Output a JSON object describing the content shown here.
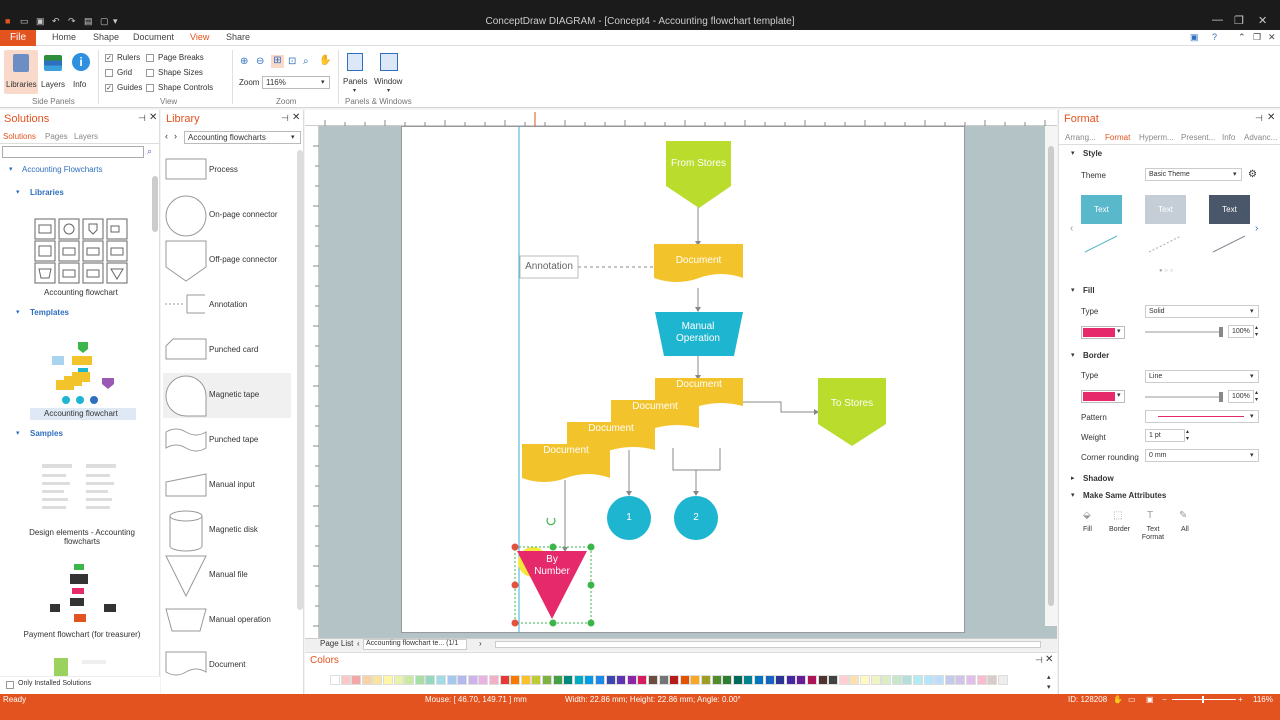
{
  "window": {
    "title": "ConceptDraw DIAGRAM - [Concept4 - Accounting flowchart template]"
  },
  "menu": {
    "file": "File",
    "tabs": [
      "Home",
      "Shape",
      "Document",
      "View",
      "Share"
    ],
    "active": "View"
  },
  "ribbon": {
    "side_panels": {
      "libraries": "Libraries",
      "layers": "Layers",
      "info": "Info",
      "group": "Side Panels"
    },
    "view": {
      "rulers": "Rulers",
      "grid": "Grid",
      "guides": "Guides",
      "page_breaks": "Page Breaks",
      "shape_sizes": "Shape Sizes",
      "shape_controls": "Shape Controls",
      "group": "View"
    },
    "zoom": {
      "label": "Zoom",
      "value": "116%",
      "group": "Zoom"
    },
    "panels": {
      "panels": "Panels",
      "window": "Window",
      "group": "Panels & Windows"
    }
  },
  "solutions": {
    "title": "Solutions",
    "tabs": [
      "Solutions",
      "Pages",
      "Layers"
    ],
    "root": "Accounting Flowcharts",
    "libraries_h": "Libraries",
    "library_item": "Accounting flowchart",
    "templates_h": "Templates",
    "template_item": "Accounting flowchart",
    "samples_h": "Samples",
    "sample1": "Design elements - Accounting flowcharts",
    "sample2": "Payment flowchart (for treasurer)",
    "only_installed": "Only Installed Solutions"
  },
  "library": {
    "title": "Library",
    "dropdown": "Accounting flowcharts",
    "items": [
      "Process",
      "On-page connector",
      "Off-page connector",
      "Annotation",
      "Punched card",
      "Magnetic tape",
      "Punched tape",
      "Manual input",
      "Magnetic disk",
      "Manual file",
      "Manual operation",
      "Document"
    ]
  },
  "diagram": {
    "from_stores": "From Stores",
    "doc1": "Document",
    "annotation": "Annotation",
    "manual_op": "Manual Operation",
    "doc_a": "Document",
    "doc_b": "Document",
    "doc_c": "Document",
    "doc_d": "Document",
    "to_stores": "To Stores",
    "c1": "1",
    "c2": "2",
    "by_number": "By Number"
  },
  "page_list": {
    "label": "Page List",
    "page": "Accounting flowchart te... (1/1"
  },
  "colors_panel": {
    "title": "Colors"
  },
  "format": {
    "title": "Format",
    "tabs": [
      "Arrang...",
      "Format",
      "Hyperm...",
      "Present...",
      "Info",
      "Advanc..."
    ],
    "style_h": "Style",
    "theme_label": "Theme",
    "theme_value": "Basic Theme",
    "swatch_text": "Text",
    "fill_h": "Fill",
    "fill_type_label": "Type",
    "fill_type": "Solid",
    "fill_opacity": "100%",
    "border_h": "Border",
    "border_type_label": "Type",
    "border_type": "Line",
    "border_opacity": "100%",
    "pattern_label": "Pattern",
    "weight_label": "Weight",
    "weight": "1 pt",
    "corner_label": "Corner rounding",
    "corner": "0 mm",
    "shadow_h": "Shadow",
    "msa_h": "Make Same Attributes",
    "msa": [
      "Fill",
      "Border",
      "Text Format",
      "All"
    ]
  },
  "status": {
    "ready": "Ready",
    "mouse": "Mouse: [ 46.70, 149.71 ] mm",
    "size": "Width: 22.86 mm;  Height: 22.86 mm;  Angle: 0.00°",
    "id": "ID: 128208",
    "zoom": "116%"
  },
  "colors": {
    "accent": "#e2531f",
    "yellow": "#f3c32b",
    "green": "#b9dc2d",
    "cyan": "#1eb5d0",
    "pink": "#e5296a"
  }
}
